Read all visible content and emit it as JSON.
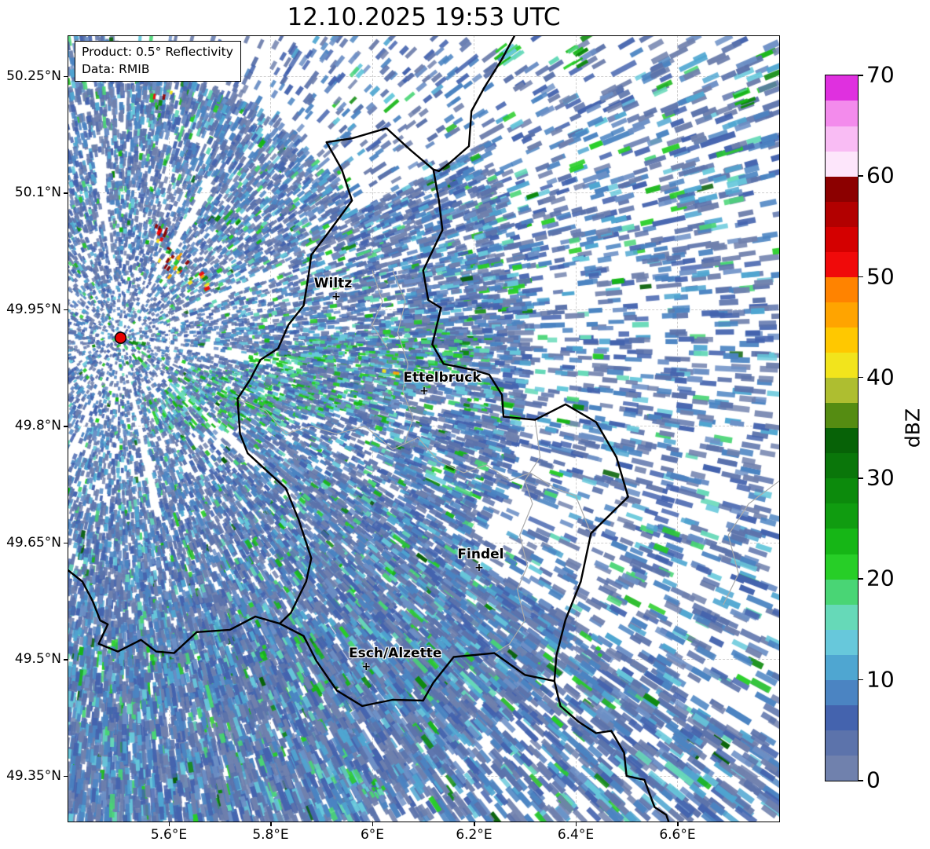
{
  "title": "12.10.2025 19:53 UTC",
  "info_box": {
    "line1": "Product: 0.5° Reflectivity",
    "line2": "Data: RMIB"
  },
  "axes": {
    "lon_range": [
      5.4008,
      6.8016
    ],
    "lat_range": [
      49.2904,
      50.3025
    ],
    "lon_ticks": [
      {
        "label": "5.6°E",
        "value": 5.6
      },
      {
        "label": "5.8°E",
        "value": 5.8
      },
      {
        "label": "6°E",
        "value": 6.0
      },
      {
        "label": "6.2°E",
        "value": 6.2
      },
      {
        "label": "6.4°E",
        "value": 6.4
      },
      {
        "label": "6.6°E",
        "value": 6.6
      }
    ],
    "lat_ticks": [
      {
        "label": "50.25°N",
        "value": 50.25
      },
      {
        "label": "50.1°N",
        "value": 50.1
      },
      {
        "label": "49.95°N",
        "value": 49.95
      },
      {
        "label": "49.8°N",
        "value": 49.8
      },
      {
        "label": "49.65°N",
        "value": 49.65
      },
      {
        "label": "49.5°N",
        "value": 49.5
      },
      {
        "label": "49.35°N",
        "value": 49.35
      }
    ]
  },
  "colorbar": {
    "unit_label": "dBZ",
    "min": 0,
    "max": 70,
    "segment_step": 2.5,
    "tick_values": [
      0,
      10,
      20,
      30,
      40,
      50,
      60,
      70
    ],
    "colors_bottom_to_top": [
      "#7081AD",
      "#5C73AB",
      "#4463AE",
      "#4B84C2",
      "#4FA6D1",
      "#67C8DB",
      "#66D9B8",
      "#49D575",
      "#27CE27",
      "#16B616",
      "#109C10",
      "#0C8A0C",
      "#0A760A",
      "#076207",
      "#558C12",
      "#AEBE30",
      "#F2E41C",
      "#FFC800",
      "#FFA400",
      "#FF8300",
      "#F00A0A",
      "#D40000",
      "#B20000",
      "#8C0000",
      "#FDE6FB",
      "#F9BCF4",
      "#F38BEC",
      "#DF30DF"
    ]
  },
  "cities": [
    {
      "name": "Wiltz",
      "lon": 5.929,
      "lat": 49.966
    },
    {
      "name": "Ettelbruck",
      "lon": 6.102,
      "lat": 49.845
    },
    {
      "name": "Findel",
      "lon": 6.21,
      "lat": 49.618
    },
    {
      "name": "Esch/Alzette",
      "lon": 5.988,
      "lat": 49.49
    }
  ],
  "radar_site": {
    "lon": 5.505,
    "lat": 49.9135,
    "dot_color": "#E60000"
  },
  "map_style": {
    "country_border_color": "#000000",
    "admin_border_color": "#ABABAB",
    "grid_color": "#CFCFCF"
  }
}
